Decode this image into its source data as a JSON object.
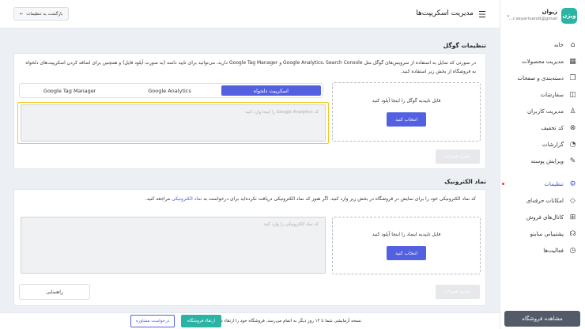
{
  "store": {
    "logo_text": "ویژن",
    "name": "زیوان",
    "email": "r.seyarivandi@gmail..."
  },
  "sidebar": {
    "items": [
      {
        "label": "خانه",
        "icon": "home-icon"
      },
      {
        "label": "مدیریت محصولات",
        "icon": "grid-icon"
      },
      {
        "label": "دسته‌بندی و صفحات",
        "icon": "copy-icon"
      },
      {
        "label": "سفارشات",
        "icon": "bag-icon"
      },
      {
        "label": "مدیریت کاربران",
        "icon": "user-icon"
      },
      {
        "label": "کد تخفیف",
        "icon": "percent-icon"
      },
      {
        "label": "گزارشات",
        "icon": "chart-icon"
      },
      {
        "label": "ویرایش پوسته",
        "icon": "edit-icon"
      },
      {
        "label": "تنظیمات",
        "icon": "gear-icon",
        "active": true
      },
      {
        "label": "امکانات حرفه‌ای",
        "icon": "diamond-icon"
      },
      {
        "label": "کانال‌های فروش",
        "icon": "channels-icon"
      },
      {
        "label": "پشتیبانی سایتو",
        "icon": "headset-icon"
      },
      {
        "label": "فعالیت‌ها",
        "icon": "clock-icon"
      }
    ],
    "view_store": "مشاهده فروشگاه"
  },
  "header": {
    "title": "مدیریت اسکریپت‌ها",
    "back_button": "بازگشت به تنظیمات"
  },
  "google": {
    "title": "تنظیمات گوگل",
    "description": "در صورتی که تمایل به استفاده از سرویس‌های گوگل مثل Google Analytics، Search Console و Google Tag Manager دارید، می‌توانید برای تایید دامنه (به صورت آپلود فایل) و همچنین برای اضافه کردن اسکریپت‌های دلخواه به فروشگاه از بخش زیر استفاده کنید.",
    "upload_label": "فایل تاییدیه گوگل را اینجا آپلود کنید",
    "upload_button": "انتخاب کنید",
    "tabs": [
      "اسکریپت دلخواه",
      "Google Analytics",
      "Google Tag Manager"
    ],
    "textarea_placeholder": "کد Google Analytics را اینجا وارد کنید",
    "save_button": "ذخیره تغییرات"
  },
  "enamad": {
    "title": "نماد الکترونیک",
    "description_main": "کد نماد الکترونیکی خود را برای نمایش در فروشگاه در بخش زیر وارد کنید. اگر هنوز کد نماد الکترونیکی دریافت نکرده‌اید برای درخواست به",
    "description_link": "نماد الکترونیکی",
    "description_end": "مراجعه کنید.",
    "upload_label": "فایل تاییدیه اینماد را اینجا آپلود کنید",
    "upload_button": "انتخاب کنید",
    "textarea_placeholder": "کد نماد الکترونیکی را وارد کنید",
    "save_button": "ذخیره تغییرات",
    "guide_button": "راهنمایی"
  },
  "footer": {
    "trial_text": "نسخه آزمایشی شما تا ۱۴ روز دیگر به اتمام می‌رسد. فروشگاه خود را ارتقاء دهید.",
    "upgrade_button": "ارتقاء فروشگاه",
    "consult_button": "درخواست مشاوره"
  },
  "colors": {
    "accent": "#5360e0",
    "brand": "#2bb3a3",
    "highlight": "#f2c81e"
  }
}
